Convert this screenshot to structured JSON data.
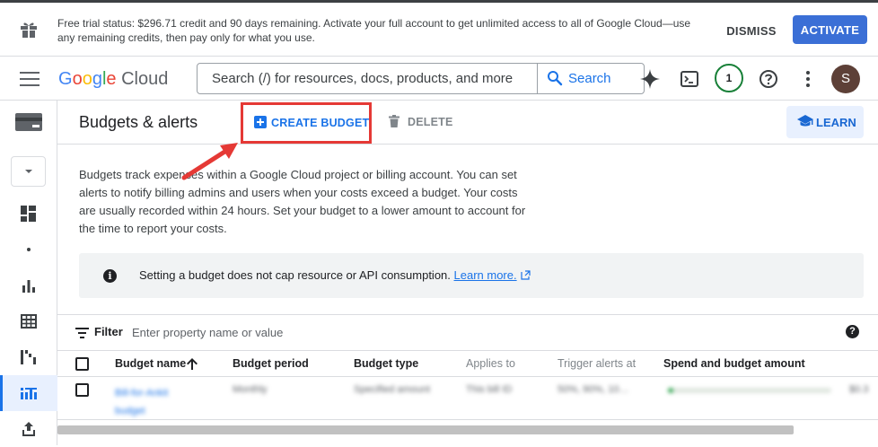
{
  "banner": {
    "message": "Free trial status: $296.71 credit and 90 days remaining. Activate your full account to get unlimited access to all of Google Cloud—use any remaining credits, then pay only for what you use.",
    "dismiss_label": "DISMISS",
    "activate_label": "ACTIVATE"
  },
  "header": {
    "logo_google": [
      "G",
      "o",
      "o",
      "g",
      "l",
      "e"
    ],
    "logo_cloud": "Cloud",
    "search_placeholder": "Search (/) for resources, docs, products, and more",
    "search_button_label": "Search",
    "notifications_count": "1",
    "avatar_initial": "S"
  },
  "colors": {
    "google_blue": "#4285F4",
    "google_red": "#EA4335",
    "google_yellow": "#FBBC05",
    "google_green": "#34A853",
    "accent": "#1a73e8",
    "highlight_box": "#e53935"
  },
  "sidebar": {
    "icons": [
      "billing-icon",
      "dropdown-icon",
      "dashboard-icon",
      "dot-icon",
      "reports-icon",
      "table-breakdown-icon",
      "cost-trend-icon",
      "budgets-icon",
      "export-icon"
    ],
    "active": "budgets-icon"
  },
  "page": {
    "title": "Budgets & alerts",
    "create_label": "CREATE BUDGET",
    "delete_label": "DELETE",
    "learn_label": "LEARN",
    "description": "Budgets track expenses within a Google Cloud project or billing account. You can set alerts to notify billing admins and users when your costs exceed a budget. Your costs are usually recorded within 24 hours. Set your budget to a lower amount to account for the time to report your costs.",
    "info_text": "Setting a budget does not cap resource or API consumption.",
    "info_link": "Learn more."
  },
  "filter": {
    "label": "Filter",
    "placeholder": "Enter property name or value"
  },
  "table": {
    "columns": [
      "Budget name",
      "Budget period",
      "Budget type",
      "Applies to",
      "Trigger alerts at",
      "Spend and budget amount"
    ],
    "sorted_column": "Budget name",
    "rows": [
      {
        "name": "Bill-for-Ankit budget",
        "period": "Monthly",
        "type": "Specified amount",
        "applies_to": "This bill ID",
        "triggers": "50%, 90%, 10…",
        "spend": "$0.3"
      }
    ]
  }
}
